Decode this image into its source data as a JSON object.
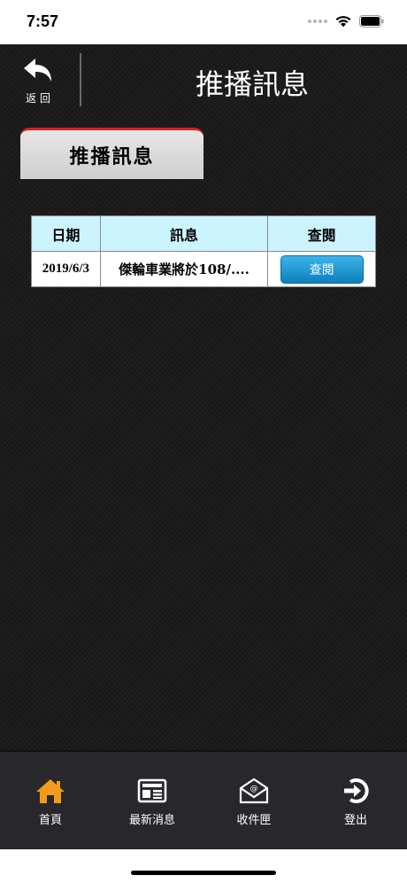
{
  "status_bar": {
    "time": "7:57"
  },
  "header": {
    "back_label": "返回",
    "title": "推播訊息"
  },
  "tab": {
    "label": "推播訊息"
  },
  "table": {
    "columns": [
      "日期",
      "訊息",
      "查閱"
    ],
    "rows": [
      {
        "date": "2019/6/3",
        "message": "傑輪車業將於108/....",
        "action": "查閱"
      }
    ]
  },
  "tab_bar": {
    "items": [
      {
        "label": "首頁",
        "icon": "home-icon"
      },
      {
        "label": "最新消息",
        "icon": "news-icon"
      },
      {
        "label": "收件匣",
        "icon": "inbox-icon"
      },
      {
        "label": "登出",
        "icon": "logout-icon"
      }
    ]
  },
  "colors": {
    "background": "#1c1c1c",
    "table_header": "#ccf4ff",
    "button": "#1a9ad6",
    "tab_accent": "#d42020",
    "home_icon": "#f29a1c"
  }
}
